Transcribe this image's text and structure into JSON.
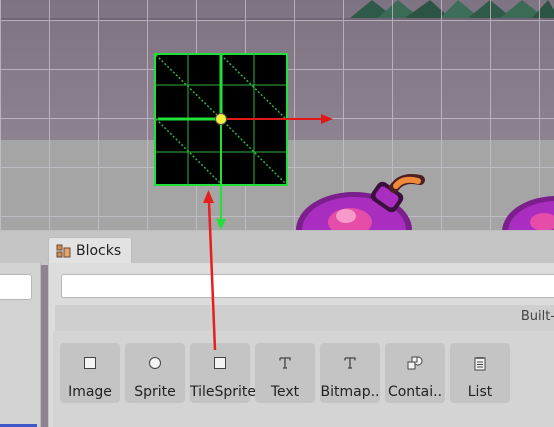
{
  "blocks_panel": {
    "tab_label": "Blocks",
    "search_value": "",
    "group_label": "Built-",
    "blocks": [
      {
        "label": "Image",
        "icon": "square-icon"
      },
      {
        "label": "Sprite",
        "icon": "circle-icon"
      },
      {
        "label": "TileSprite",
        "icon": "square-icon"
      },
      {
        "label": "Text",
        "icon": "text-t-icon"
      },
      {
        "label": "Bitmap..",
        "icon": "text-t-icon"
      },
      {
        "label": "Contai..",
        "icon": "shapes-icon"
      },
      {
        "label": "List",
        "icon": "notepad-icon"
      }
    ]
  },
  "colors": {
    "selection_outline": "#22e03a",
    "gizmo_x_axis": "#e01818",
    "gizmo_y_axis": "#22e03a",
    "gizmo_center": "#f5ee3c",
    "drag_arrow": "#e61e1e",
    "left_panel_accent": "#3f58c8"
  }
}
